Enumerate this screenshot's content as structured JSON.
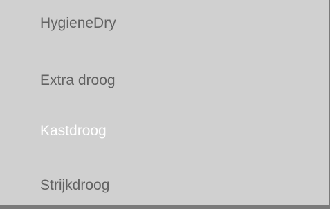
{
  "menu": {
    "items": [
      {
        "label": "HygieneDry",
        "selected": false
      },
      {
        "label": "Extra droog",
        "selected": false
      },
      {
        "label": "Kastdroog",
        "selected": true
      },
      {
        "label": "Strijkdroog",
        "selected": false
      }
    ]
  },
  "colors": {
    "background": "#d0d0d0",
    "text": "#626262",
    "selected_text": "#ffffff",
    "border": "#7a7a7a"
  }
}
